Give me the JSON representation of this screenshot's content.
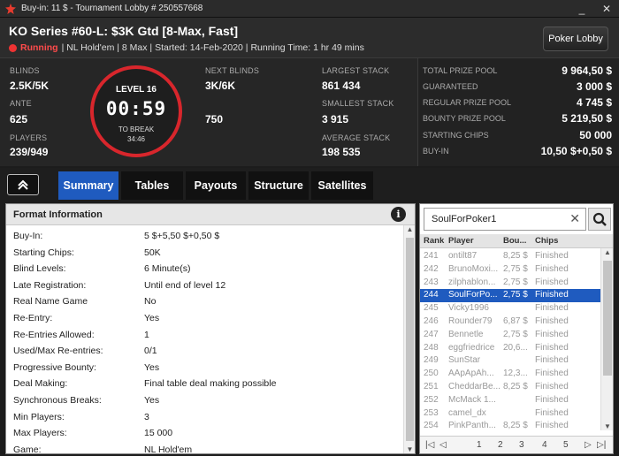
{
  "window": {
    "title": "Buy-in: 11 $ - Tournament Lobby # 250557668"
  },
  "header": {
    "tournament_name": "KO Series #60-L: $3K Gtd [8-Max, Fast]",
    "status": "Running",
    "details": "| NL Hold'em | 8 Max | Started: 14-Feb-2020 | Running Time: 1 hr  49 mins",
    "lobby_button": "Poker Lobby"
  },
  "stats": {
    "blinds_label": "BLINDS",
    "blinds": "2.5K/5K",
    "ante_label": "ANTE",
    "ante": "625",
    "players_label": "PLAYERS",
    "players": "239/949",
    "level": "LEVEL 16",
    "clock": "00:59",
    "to_break_label": "TO BREAK",
    "to_break": "34:46",
    "next_blinds_label": "NEXT BLINDS",
    "next_blinds": "3K/6K",
    "next_ante": "750",
    "largest_stack_label": "LARGEST STACK",
    "largest_stack": "861 434",
    "smallest_stack_label": "SMALLEST STACK",
    "smallest_stack": "3 915",
    "average_stack_label": "AVERAGE STACK",
    "average_stack": "198 535"
  },
  "prize": [
    {
      "label": "TOTAL PRIZE POOL",
      "value": "9 964,50 $"
    },
    {
      "label": "GUARANTEED",
      "value": "3 000 $"
    },
    {
      "label": "REGULAR PRIZE POOL",
      "value": "4 745 $"
    },
    {
      "label": "BOUNTY PRIZE POOL",
      "value": "5 219,50 $"
    },
    {
      "label": "STARTING CHIPS",
      "value": "50 000"
    },
    {
      "label": "BUY-IN",
      "value": "10,50 $+0,50 $"
    }
  ],
  "tabs": [
    "Summary",
    "Tables",
    "Payouts",
    "Structure",
    "Satellites"
  ],
  "format": {
    "title": "Format Information",
    "rows": [
      {
        "k": "Buy-In:",
        "v": "5 $+5,50 $+0,50 $"
      },
      {
        "k": "Starting Chips:",
        "v": "50K"
      },
      {
        "k": "Blind Levels:",
        "v": "6 Minute(s)"
      },
      {
        "k": "Late Registration:",
        "v": "Until end of level 12"
      },
      {
        "k": "Real Name Game",
        "v": "No"
      },
      {
        "k": "Re-Entry:",
        "v": "Yes"
      },
      {
        "k": "Re-Entries Allowed:",
        "v": "1"
      },
      {
        "k": "Used/Max Re-entries:",
        "v": "0/1"
      },
      {
        "k": "Progressive Bounty:",
        "v": "Yes"
      },
      {
        "k": "Deal Making:",
        "v": "Final table deal making possible"
      },
      {
        "k": "Synchronous Breaks:",
        "v": "Yes"
      },
      {
        "k": "Min Players:",
        "v": "3"
      },
      {
        "k": "Max Players:",
        "v": "15 000"
      },
      {
        "k": "Game:",
        "v": "NL Hold'em"
      }
    ]
  },
  "players": {
    "search_value": "SoulForPoker1",
    "columns": [
      "Rank",
      "Player",
      "Bou...",
      "Chips"
    ],
    "rows": [
      {
        "rank": "241",
        "player": "ontilt87",
        "bounty": "8,25 $",
        "chips": "Finished"
      },
      {
        "rank": "242",
        "player": "BrunoMoxi...",
        "bounty": "2,75 $",
        "chips": "Finished"
      },
      {
        "rank": "243",
        "player": "zilphablon...",
        "bounty": "2,75 $",
        "chips": "Finished"
      },
      {
        "rank": "244",
        "player": "SoulForPo...",
        "bounty": "2,75 $",
        "chips": "Finished"
      },
      {
        "rank": "245",
        "player": "Vicky1996",
        "bounty": "",
        "chips": "Finished"
      },
      {
        "rank": "246",
        "player": "Rounder79",
        "bounty": "6,87 $",
        "chips": "Finished"
      },
      {
        "rank": "247",
        "player": "Bennetle",
        "bounty": "2,75 $",
        "chips": "Finished"
      },
      {
        "rank": "248",
        "player": "eggfriedrice",
        "bounty": "20,6...",
        "chips": "Finished"
      },
      {
        "rank": "249",
        "player": "SunStar",
        "bounty": "",
        "chips": "Finished"
      },
      {
        "rank": "250",
        "player": "AApApAh...",
        "bounty": "12,3...",
        "chips": "Finished"
      },
      {
        "rank": "251",
        "player": "CheddarBe...",
        "bounty": "8,25 $",
        "chips": "Finished"
      },
      {
        "rank": "252",
        "player": "McMack 1...",
        "bounty": "",
        "chips": "Finished"
      },
      {
        "rank": "253",
        "player": "camel_dx",
        "bounty": "",
        "chips": "Finished"
      },
      {
        "rank": "254",
        "player": "PinkPanth...",
        "bounty": "8,25 $",
        "chips": "Finished"
      }
    ],
    "pages": [
      "1",
      "2",
      "3",
      "4",
      "5"
    ]
  }
}
